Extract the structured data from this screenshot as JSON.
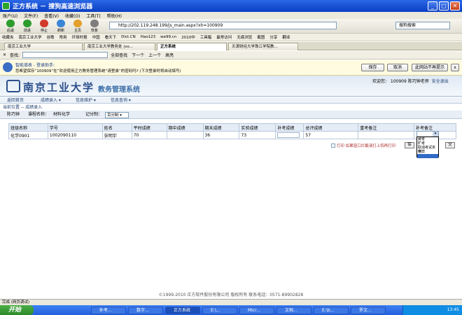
{
  "window": {
    "title": "正方系统 － 搜狗高速浏览器"
  },
  "menu": [
    "账户(U)",
    "文件(F)",
    "查看(V)",
    "收藏(O)",
    "工具(T)",
    "帮助(H)"
  ],
  "toolbar": {
    "buttons": [
      "后退",
      "前进",
      "停止",
      "刷新",
      "主页",
      "恢复",
      "收藏",
      "收藏栏"
    ],
    "address": "http://202.119.248.199/js_main.aspx?xh=100909",
    "search_placeholder": "搜狗搜索"
  },
  "favorites": [
    "收藏夹",
    "南京工业大学",
    "谷歌",
    "常用",
    "环球时报",
    "中国",
    "看天下",
    "Dict.CN",
    "Hao123",
    "we99.cn",
    "2010中",
    "工具箱",
    "最常访问",
    "无痕浏览",
    "截图",
    "分享",
    "翻译"
  ],
  "tabs": [
    {
      "label": "南京工业大学"
    },
    {
      "label": "南京工业大学教务处 |vo..."
    },
    {
      "label": "正方系统",
      "active": true
    },
    {
      "label": "天津财经大学珠江学院教..."
    }
  ],
  "find": {
    "label": "查找:",
    "next": "下一个",
    "prev": "上一个",
    "highlight": "高亮",
    "highlight_all": "全部查找"
  },
  "password_helper": {
    "title": "智能填表 - 登录助手:",
    "message": "您希望保存“100909”在“欢迎使用正方教务管理系统”请登录”的密码吗? (下次登录时将自动填写)",
    "save": "保存",
    "cancel": "取消",
    "never": "此网站不再提示",
    "close": "x"
  },
  "site": {
    "logo_text": "南京工业大学",
    "system_title": "教务管理系统",
    "welcome": "欢迎您：  100909 陈巧钟老师",
    "safe_exit": "安全退出"
  },
  "nav": [
    "返回首页",
    "成绩录入 ▾",
    "信息维护 ▾",
    "信息查询 ▾"
  ],
  "breadcrumb": "当前位置 -- 成绩录入",
  "info": {
    "teacher_label": "陈巧钟",
    "course_label": "课程名称：",
    "course_value": "材料化学",
    "score_label": "记分制：",
    "score_value": "百分制"
  },
  "table": {
    "headers": [
      "班级名称",
      "学号",
      "姓名",
      "平时成绩",
      "期中成绩",
      "期末成绩",
      "实验成绩",
      "补考成绩",
      "总评成绩",
      "重考备注",
      "补考备注"
    ],
    "rows": [
      {
        "class": "化学0901",
        "student_id": "1002090110",
        "name": "张明宇",
        "regular": "70",
        "midterm": "",
        "final": "36",
        "lab": "73",
        "makeup": "",
        "total": "57",
        "retake_note": ""
      }
    ]
  },
  "dropdown": {
    "options": [
      "缓考",
      "旷考",
      "取消考试资格",
      "作弊",
      ""
    ],
    "selected_index": 4
  },
  "actions": {
    "print_note": "打印 如果窗口拦截请打上钩再打印",
    "save": "保",
    "submit": "交"
  },
  "footer": "©1999-2010  正方软件股份有限公司  版权所有  联系电话：0571-89902828",
  "statusbar": "完成 (网页调试)",
  "taskbar": {
    "start": "开始",
    "items": [
      "补考...",
      "数字...",
      "正方系统",
      "E:\\...",
      "Micr...",
      "文档...",
      "E:\\b...",
      "罗文..."
    ],
    "clock": "13:45"
  }
}
